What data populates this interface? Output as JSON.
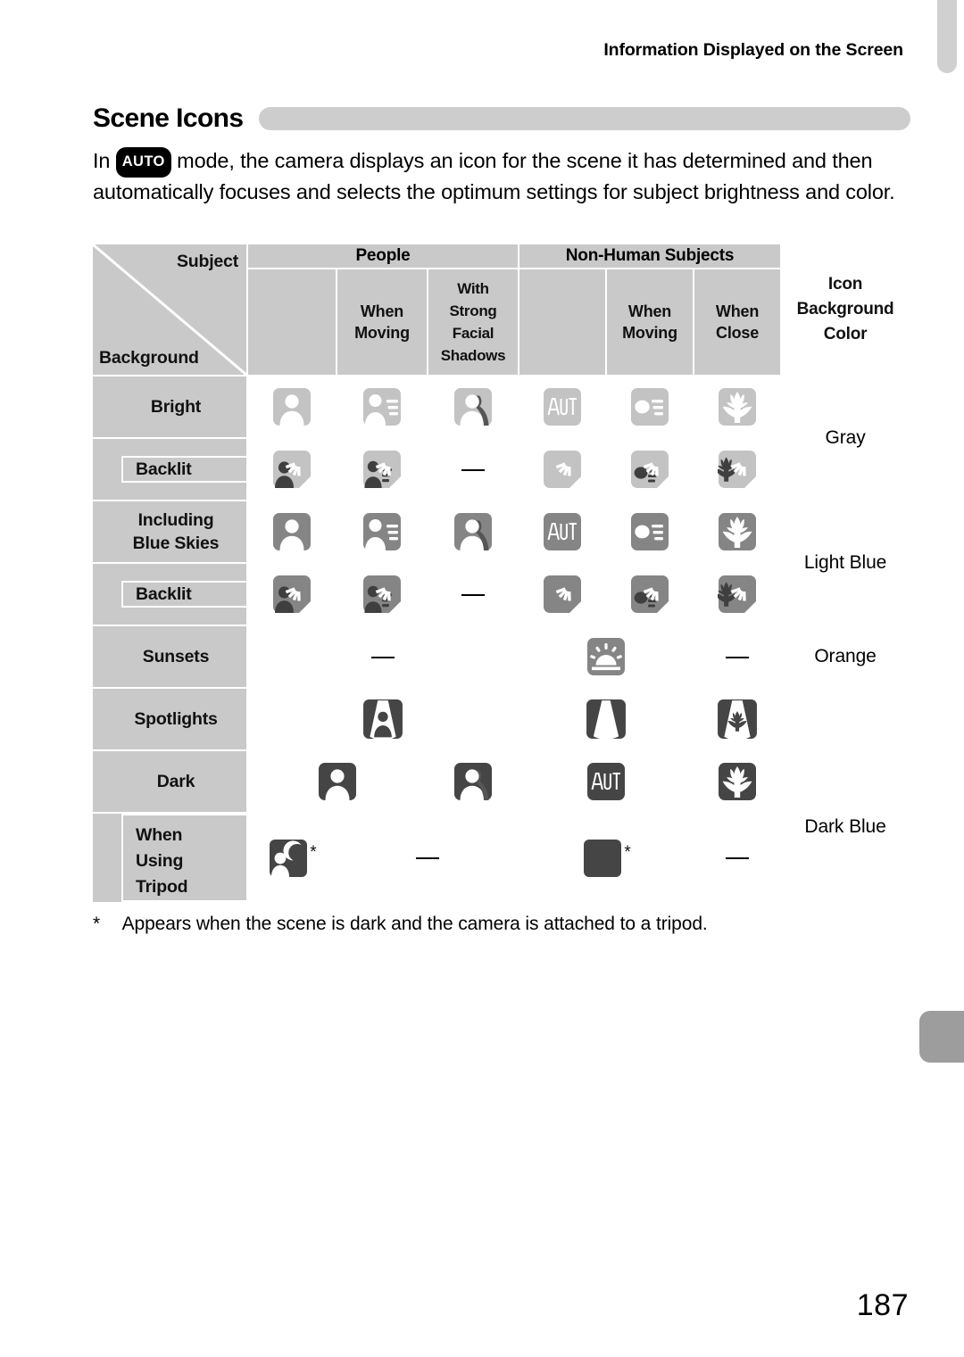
{
  "running_header": "Information Displayed on the Screen",
  "section": {
    "title": "Scene Icons"
  },
  "intro": {
    "before": "In",
    "badge": "AUTO",
    "after": "mode, the camera displays an icon for the scene it has determined and then automatically focuses and selects the optimum settings for subject brightness and color."
  },
  "table": {
    "corner": {
      "subject": "Subject",
      "background": "Background"
    },
    "groups": {
      "people": "People",
      "non_human": "Non-Human Subjects",
      "icon_color": "Icon\nBackground\nColor"
    },
    "icon_color_lines": [
      "Icon",
      "Background",
      "Color"
    ],
    "subheaders": {
      "people_plain": "",
      "people_moving": [
        "When",
        "Moving"
      ],
      "people_shadow": [
        "With",
        "Strong",
        "Facial",
        "Shadows"
      ],
      "nonhuman_plain": "",
      "nonhuman_moving": [
        "When",
        "Moving"
      ],
      "nonhuman_close": [
        "When",
        "Close"
      ]
    },
    "rows": [
      {
        "label": "Bright",
        "indent": false,
        "cells": [
          "person",
          "person-moving",
          "person-shadow",
          "auto",
          "macro-moving",
          "flower"
        ],
        "tone": "light"
      },
      {
        "label": "Backlit",
        "indent": true,
        "cells": [
          "person-backlit",
          "person-moving-backlit",
          "dash",
          "backlit",
          "macro-moving-backlit",
          "flower-backlit"
        ],
        "tone": "light"
      },
      {
        "label": "Including\nBlue Skies",
        "label_lines": [
          "Including",
          "Blue Skies"
        ],
        "indent": false,
        "cells": [
          "person",
          "person-moving",
          "person-shadow",
          "auto",
          "macro-moving",
          "flower"
        ],
        "tone": "mid"
      },
      {
        "label": "Backlit",
        "indent": true,
        "cells": [
          "person-backlit",
          "person-moving-backlit",
          "dash",
          "backlit",
          "macro-moving-backlit",
          "flower-backlit"
        ],
        "tone": "mid"
      },
      {
        "label": "Sunsets",
        "indent": false,
        "cells": [
          "dash",
          "sunset",
          "dash"
        ],
        "tone": "mid"
      },
      {
        "label": "Spotlights",
        "indent": false,
        "cells": [
          "spotlight-person",
          "spotlight",
          "spotlight-flower"
        ],
        "tone": "dark"
      },
      {
        "label": "Dark",
        "indent": false,
        "cells": [
          "person",
          "person-shadow",
          "auto",
          "flower"
        ],
        "tone": "dark"
      },
      {
        "label": "When\nUsing\nTripod",
        "label_lines": [
          "When",
          "Using",
          "Tripod"
        ],
        "indent": true,
        "cells": [
          "night-portrait-star",
          "dash",
          "moon-star",
          "dash"
        ],
        "tone": "dark"
      }
    ],
    "colors": [
      {
        "label": "Gray",
        "span_rows": 2
      },
      {
        "label": "Light Blue",
        "span_rows": 2
      },
      {
        "label": "Orange",
        "span_rows": 1
      },
      {
        "label": "",
        "span_rows": 1
      },
      {
        "label": "Dark Blue",
        "span_rows": 2
      }
    ],
    "color_values": {
      "gray": "Gray",
      "light_blue": "Light Blue",
      "orange": "Orange",
      "dark_blue": "Dark Blue"
    }
  },
  "footnote": {
    "marker": "*",
    "text": "Appears when the scene is dark and the camera is attached to a tripod."
  },
  "page_number": "187",
  "palette": {
    "header_gray": "#c9c9c9",
    "icon_light": "#c3c3c3",
    "icon_mid": "#858585",
    "icon_dark": "#454545",
    "bar_gray": "#cdcdcd",
    "tab_top": "#d0d0d0",
    "tab_mid": "#9d9d9d"
  }
}
